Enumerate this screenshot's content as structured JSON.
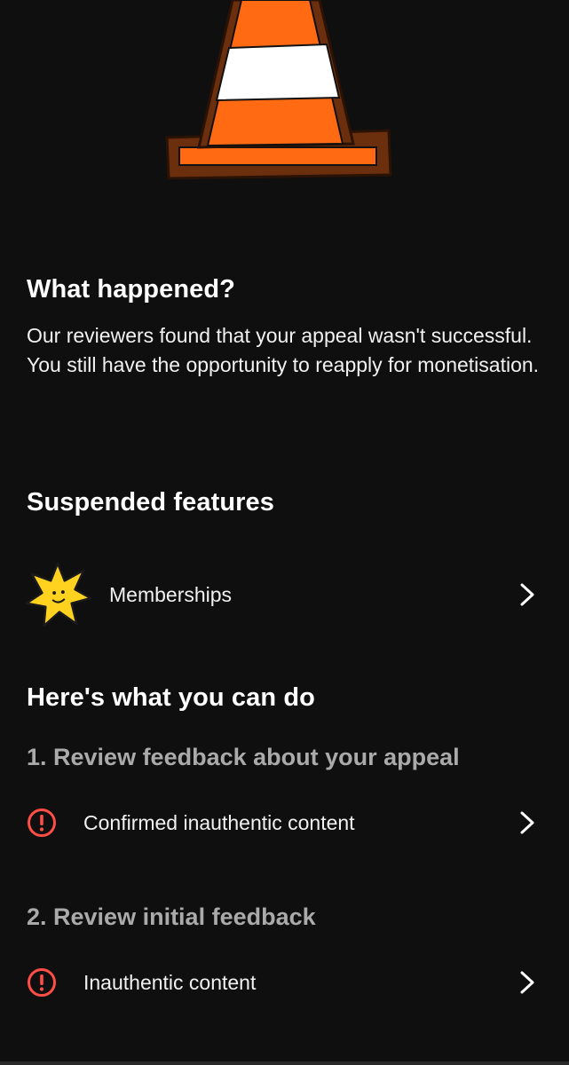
{
  "illustration": {
    "icon": "traffic-cone-illustration"
  },
  "what_happened": {
    "heading": "What happened?",
    "body": "Our reviewers found that your appeal wasn't successful. You still have the opportunity to reapply for monetisation."
  },
  "suspended_features": {
    "heading": "Suspended features",
    "items": [
      {
        "label": "Memberships",
        "icon": "star-icon"
      }
    ]
  },
  "what_you_can_do": {
    "heading": "Here's what you can do",
    "steps": [
      {
        "title": "1. Review feedback about your appeal",
        "items": [
          {
            "label": "Confirmed inauthentic content",
            "icon": "alert-icon"
          }
        ]
      },
      {
        "title": "2. Review initial feedback",
        "items": [
          {
            "label": "Inauthentic content",
            "icon": "alert-icon"
          }
        ]
      }
    ]
  },
  "colors": {
    "background": "#0f0f0f",
    "alert": "#ff4e45",
    "cone_orange": "#ff6a13",
    "cone_outline": "#6b2f0e"
  }
}
